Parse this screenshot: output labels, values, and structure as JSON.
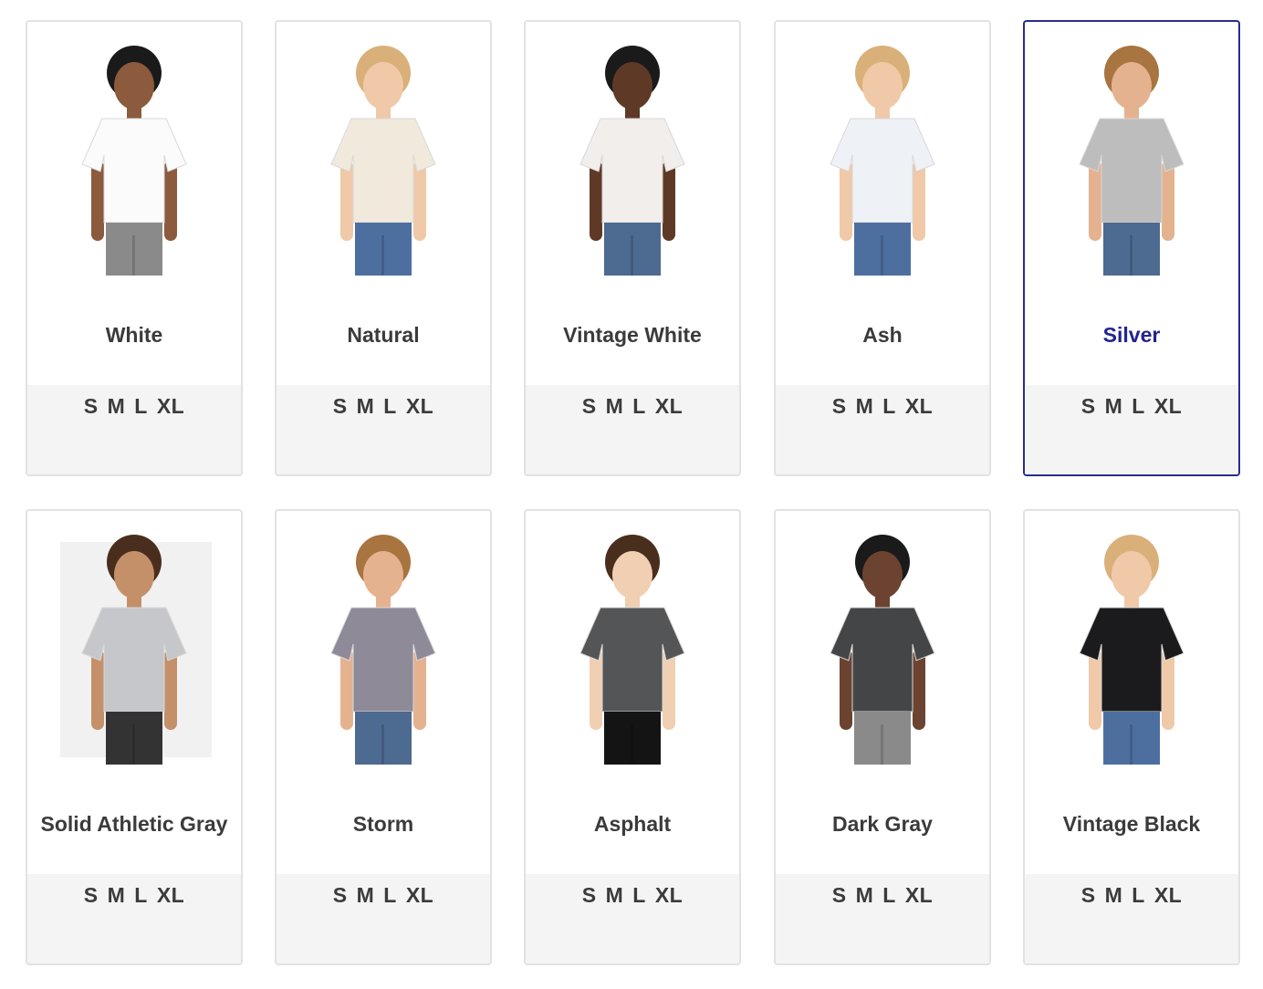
{
  "colors": {
    "selected_border": "#2b2b8c",
    "selected_text": "#23238e",
    "card_border": "#e2e2e2",
    "size_bar_bg": "#f4f4f4",
    "text": "#3b3b3b"
  },
  "swatches": [
    {
      "name": "White",
      "shirt": "#fbfbfb",
      "pants": "#8a8a8a",
      "hair": "#1a1a1a",
      "skin": "#8c5a3c",
      "selected": false,
      "sizes": [
        "S",
        "M",
        "L",
        "XL"
      ]
    },
    {
      "name": "Natural",
      "shirt": "#f1e9dc",
      "pants": "#4d6fa0",
      "hair": "#d9b07a",
      "skin": "#f0c9a8",
      "selected": false,
      "sizes": [
        "S",
        "M",
        "L",
        "XL"
      ]
    },
    {
      "name": "Vintage White",
      "shirt": "#f2eeec",
      "pants": "#4d6a90",
      "hair": "#1a1a1a",
      "skin": "#5e3a26",
      "selected": false,
      "sizes": [
        "S",
        "M",
        "L",
        "XL"
      ]
    },
    {
      "name": "Ash",
      "shirt": "#eef1f6",
      "pants": "#4d6fa0",
      "hair": "#d9b07a",
      "skin": "#f0c9a8",
      "selected": false,
      "sizes": [
        "S",
        "M",
        "L",
        "XL"
      ]
    },
    {
      "name": "Silver",
      "shirt": "#bdbdbd",
      "pants": "#4d6a90",
      "hair": "#a8743f",
      "skin": "#e5b28f",
      "selected": true,
      "sizes": [
        "S",
        "M",
        "L",
        "XL"
      ]
    },
    {
      "name": "Solid Athletic Gray",
      "shirt": "#c6c7cb",
      "pants": "#333333",
      "hair": "#4a2e1d",
      "skin": "#c4906a",
      "selected": false,
      "sizes": [
        "S",
        "M",
        "L",
        "XL"
      ],
      "photo_bg": true
    },
    {
      "name": "Storm",
      "shirt": "#8f8a98",
      "pants": "#4d6a90",
      "hair": "#a8743f",
      "skin": "#e5b28f",
      "selected": false,
      "sizes": [
        "S",
        "M",
        "L",
        "XL"
      ]
    },
    {
      "name": "Asphalt",
      "shirt": "#545557",
      "pants": "#141414",
      "hair": "#4a2e1d",
      "skin": "#f0cfb2",
      "selected": false,
      "sizes": [
        "S",
        "M",
        "L",
        "XL"
      ]
    },
    {
      "name": "Dark Gray",
      "shirt": "#444546",
      "pants": "#8a8a8a",
      "hair": "#1a1a1a",
      "skin": "#6b4330",
      "selected": false,
      "sizes": [
        "S",
        "M",
        "L",
        "XL"
      ]
    },
    {
      "name": "Vintage Black",
      "shirt": "#1b1b1d",
      "pants": "#4d6fa0",
      "hair": "#d9b07a",
      "skin": "#f0c9a8",
      "selected": false,
      "sizes": [
        "S",
        "M",
        "L",
        "XL"
      ]
    }
  ]
}
